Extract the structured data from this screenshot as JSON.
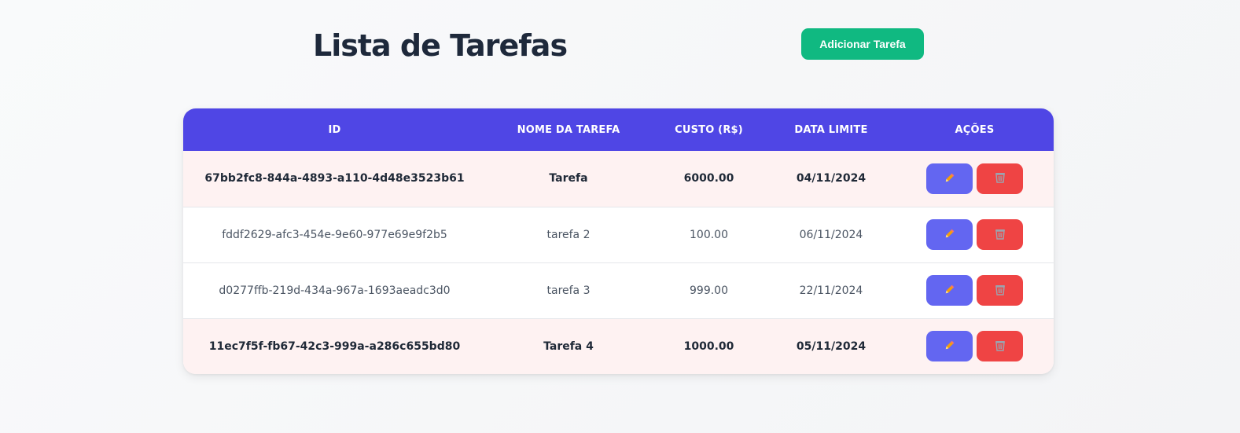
{
  "header": {
    "title": "Lista de Tarefas",
    "add_button_label": "Adicionar Tarefa"
  },
  "table": {
    "columns": [
      "ID",
      "NOME DA TAREFA",
      "CUSTO (R$)",
      "DATA LIMITE",
      "AÇÕES"
    ],
    "rows": [
      {
        "id": "67bb2fc8-844a-4893-a110-4d48e3523b61",
        "name": "Tarefa",
        "cost": "6000.00",
        "deadline": "04/11/2024",
        "highlighted": true
      },
      {
        "id": "fddf2629-afc3-454e-9e60-977e69e9f2b5",
        "name": "tarefa 2",
        "cost": "100.00",
        "deadline": "06/11/2024",
        "highlighted": false
      },
      {
        "id": "d0277ffb-219d-434a-967a-1693aeadc3d0",
        "name": "tarefa 3",
        "cost": "999.00",
        "deadline": "22/11/2024",
        "highlighted": false
      },
      {
        "id": "11ec7f5f-fb67-42c3-999a-a286c655bd80",
        "name": "Tarefa 4",
        "cost": "1000.00",
        "deadline": "05/11/2024",
        "highlighted": true
      }
    ],
    "action_icons": {
      "edit": "pencil-icon",
      "delete": "wastebasket-icon"
    }
  },
  "colors": {
    "header_bg": "#4f46e5",
    "add_button": "#10b981",
    "edit_button": "#6366f1",
    "delete_button": "#ef4444",
    "highlight_row": "#fef2f2"
  }
}
